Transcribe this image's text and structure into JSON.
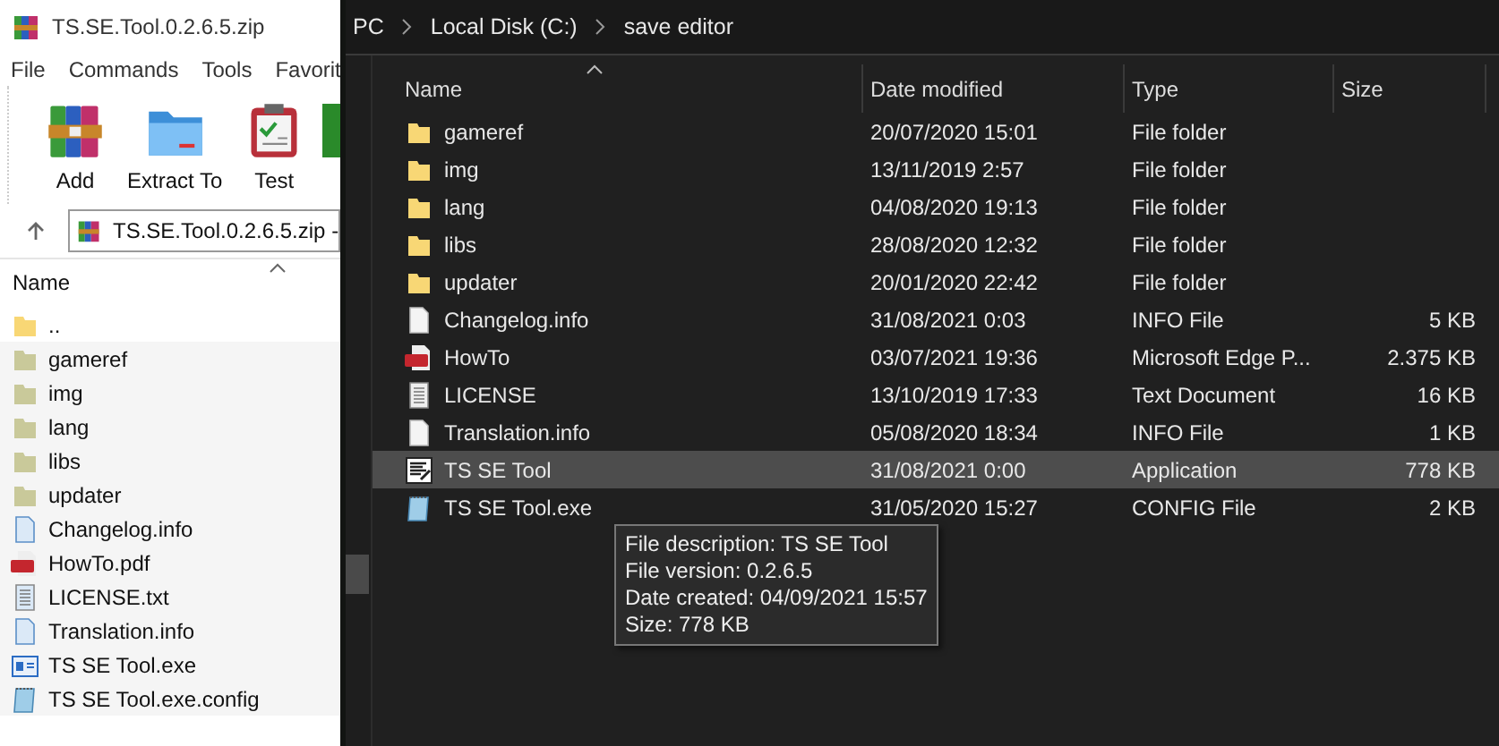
{
  "winrar": {
    "title": "TS.SE.Tool.0.2.6.5.zip",
    "menu": [
      "File",
      "Commands",
      "Tools",
      "Favorit"
    ],
    "toolbar": [
      {
        "label": "Add",
        "kind": "add"
      },
      {
        "label": "Extract To",
        "kind": "extract"
      },
      {
        "label": "Test",
        "kind": "test"
      }
    ],
    "address": "TS.SE.Tool.0.2.6.5.zip -",
    "column": "Name",
    "files": [
      {
        "name": "..",
        "kind": "up"
      },
      {
        "name": "gameref",
        "kind": "folder"
      },
      {
        "name": "img",
        "kind": "folder"
      },
      {
        "name": "lang",
        "kind": "folder"
      },
      {
        "name": "libs",
        "kind": "folder"
      },
      {
        "name": "updater",
        "kind": "folder"
      },
      {
        "name": "Changelog.info",
        "kind": "file"
      },
      {
        "name": "HowTo.pdf",
        "kind": "pdf"
      },
      {
        "name": "LICENSE.txt",
        "kind": "text"
      },
      {
        "name": "Translation.info",
        "kind": "file"
      },
      {
        "name": "TS SE Tool.exe",
        "kind": "exe"
      },
      {
        "name": "TS SE Tool.exe.config",
        "kind": "config"
      }
    ]
  },
  "explorer": {
    "breadcrumb": [
      "PC",
      "Local Disk (C:)",
      "save editor"
    ],
    "columns": [
      "Name",
      "Date modified",
      "Type",
      "Size"
    ],
    "rows": [
      {
        "name": "gameref",
        "date": "20/07/2020 15:01",
        "type": "File folder",
        "kind": "folder",
        "selected": false
      },
      {
        "name": "img",
        "date": "13/11/2019 2:57",
        "type": "File folder",
        "kind": "folder",
        "selected": false
      },
      {
        "name": "lang",
        "date": "04/08/2020 19:13",
        "type": "File folder",
        "kind": "folder",
        "selected": false
      },
      {
        "name": "libs",
        "date": "28/08/2020 12:32",
        "type": "File folder",
        "kind": "folder",
        "selected": false
      },
      {
        "name": "updater",
        "date": "20/01/2020 22:42",
        "type": "File folder",
        "kind": "folder",
        "selected": false
      },
      {
        "name": "Changelog.info",
        "date": "31/08/2021 0:03",
        "type": "INFO File",
        "size": "5 KB",
        "kind": "file",
        "selected": false
      },
      {
        "name": "HowTo",
        "date": "03/07/2021 19:36",
        "type": "Microsoft Edge P...",
        "size": "2.375 KB",
        "kind": "pdf",
        "selected": false
      },
      {
        "name": "LICENSE",
        "date": "13/10/2019 17:33",
        "type": "Text Document",
        "size": "16 KB",
        "kind": "text",
        "selected": false
      },
      {
        "name": "Translation.info",
        "date": "05/08/2020 18:34",
        "type": "INFO File",
        "size": "1 KB",
        "kind": "file",
        "selected": false
      },
      {
        "name": "TS SE Tool",
        "date": "31/08/2021 0:00",
        "type": "Application",
        "size": "778 KB",
        "kind": "app",
        "selected": true
      },
      {
        "name": "TS SE Tool.exe",
        "date": "31/05/2020 15:27",
        "type": "CONFIG File",
        "size": "2 KB",
        "kind": "config",
        "selected": false
      }
    ],
    "tooltip": [
      "File description: TS SE Tool",
      "File version: 0.2.6.5",
      "Date created: 04/09/2021 15:57",
      "Size: 778 KB"
    ]
  }
}
